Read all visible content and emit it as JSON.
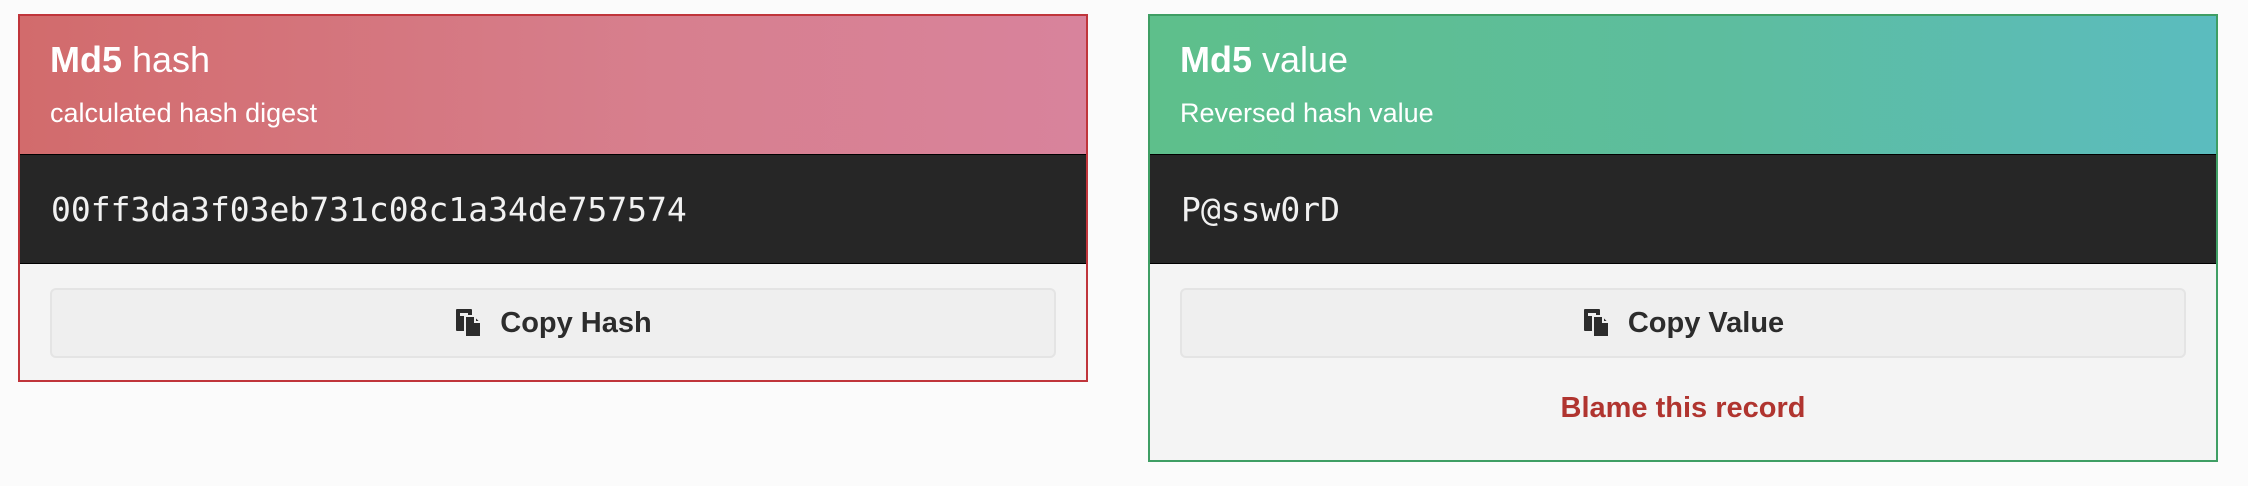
{
  "hash_card": {
    "title_bold": "Md5",
    "title_rest": "hash",
    "subtitle": "calculated hash digest",
    "hash_value": "00ff3da3f03eb731c08c1a34de757574",
    "copy_button_label": "Copy Hash",
    "copy_icon": "copy-icon",
    "accent_color": "#c0353b"
  },
  "value_card": {
    "title_bold": "Md5",
    "title_rest": "value",
    "subtitle": "Reversed hash value",
    "reversed_value": "P@ssw0rD",
    "copy_button_label": "Copy Value",
    "copy_icon": "copy-icon",
    "blame_link_label": "Blame this record",
    "accent_color": "#3f9e64",
    "blame_color": "#b0342f"
  }
}
